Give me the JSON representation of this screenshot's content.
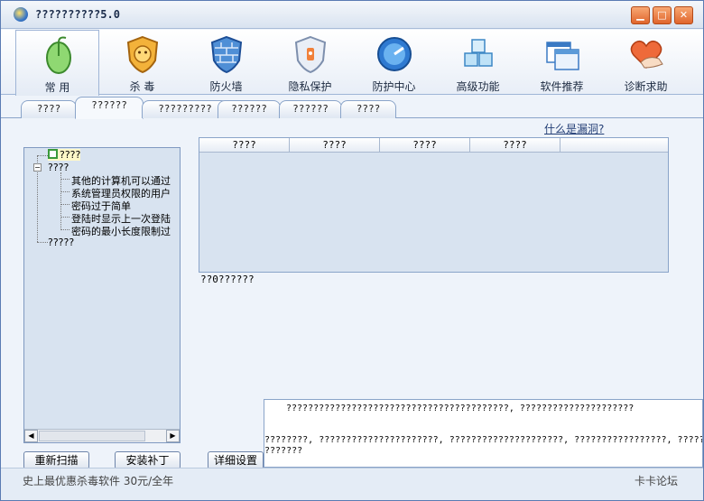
{
  "window": {
    "title": "??????????5.0",
    "minimize": "▁",
    "maximize": "□",
    "close": "✕"
  },
  "toolbar": [
    {
      "label": "常 用",
      "icon": "mouse-icon"
    },
    {
      "label": "杀 毒",
      "icon": "lion-shield-icon"
    },
    {
      "label": "防火墙",
      "icon": "firewall-shield-icon"
    },
    {
      "label": "隐私保护",
      "icon": "privacy-shield-icon"
    },
    {
      "label": "防护中心",
      "icon": "protection-center-icon"
    },
    {
      "label": "高级功能",
      "icon": "cubes-icon"
    },
    {
      "label": "软件推荐",
      "icon": "windows-icon"
    },
    {
      "label": "诊断求助",
      "icon": "heart-hand-icon"
    }
  ],
  "tabs": [
    "????",
    "??????",
    "?????????",
    "??????",
    "??????",
    "????"
  ],
  "vuln_link": "什么是漏洞?",
  "tree": {
    "root": "????",
    "group": "????",
    "children": [
      "其他的计算机可以通过",
      "系统管理员权限的用户",
      "密码过于简单",
      "登陆时显示上一次登陆",
      "密码的最小长度限制过"
    ],
    "last": "?????"
  },
  "list": {
    "columns": [
      "????",
      "????",
      "????",
      "????"
    ],
    "count_text": "??0??????"
  },
  "description": {
    "line1": "?????????????????????????????????????????, ?????????????????????",
    "line2": "????????, ??????????????????????, ?????????????????????, ?????????????????, ???????",
    "line3": "???????"
  },
  "buttons": {
    "rescan": "重新扫描",
    "install_patch": "安装补丁",
    "detail_settings": "详细设置"
  },
  "status": {
    "promo": "史上最优惠杀毒软件  30元/全年",
    "forum": "卡卡论坛"
  }
}
